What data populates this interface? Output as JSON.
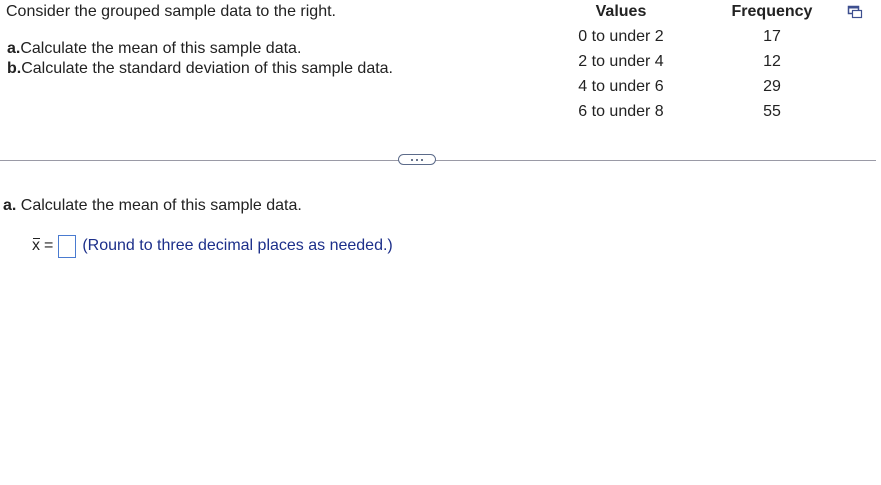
{
  "problem": {
    "intro": "Consider the grouped sample data to the right.",
    "parts": [
      {
        "marker": "a.",
        "text": "Calculate the mean of this sample data."
      },
      {
        "marker": "b.",
        "text": "Calculate the standard deviation of this sample data."
      }
    ]
  },
  "table": {
    "headers": [
      "Values",
      "Frequency"
    ],
    "rows": [
      {
        "values": "0 to under 2",
        "frequency": "17"
      },
      {
        "values": "2 to under 4",
        "frequency": "12"
      },
      {
        "values": "4 to under 6",
        "frequency": "29"
      },
      {
        "values": "6 to under 8",
        "frequency": "55"
      }
    ]
  },
  "icons": {
    "copy": "copy-icon",
    "expand": "more-dots-icon"
  },
  "question": {
    "marker": "a.",
    "text": "Calculate the mean of this sample data.",
    "variable": "x",
    "equals": "=",
    "input_value": "",
    "hint": "(Round to three decimal places as needed.)"
  },
  "colors": {
    "hint_text": "#1c2f8a",
    "input_border": "#4a7bd0",
    "divider": "#9a9aa6"
  }
}
